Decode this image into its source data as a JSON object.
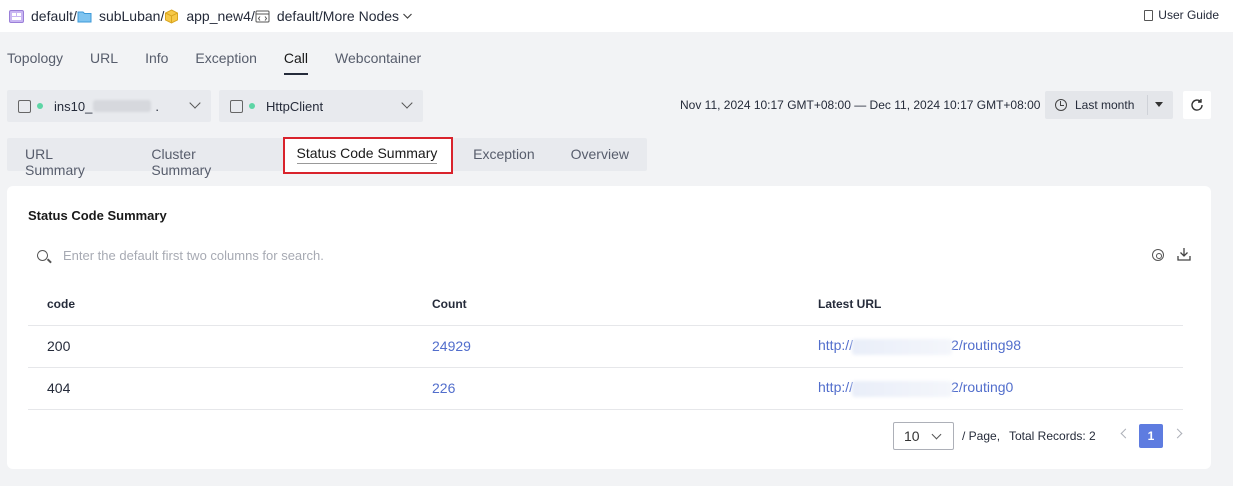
{
  "breadcrumb": {
    "items": [
      {
        "label": "default",
        "icon": "workspace-icon"
      },
      {
        "label": "subLuban",
        "icon": "folder-icon"
      },
      {
        "label": "app_new4",
        "icon": "app-cube-icon"
      },
      {
        "label": "default",
        "icon": "environment-icon"
      },
      {
        "label": "More Nodes",
        "icon": "chevron-down-icon"
      }
    ],
    "separator": "/"
  },
  "user_guide": "User Guide",
  "tabs": [
    "Topology",
    "URL",
    "Info",
    "Exception",
    "Call",
    "Webcontainer"
  ],
  "active_tab": "Call",
  "instance_select": {
    "label": "ins10_",
    "status_color": "#5dd5a5"
  },
  "client_select": {
    "label": "HttpClient",
    "status_color": "#5dd5a5"
  },
  "date_range": "Nov 11, 2024 10:17 GMT+08:00 — Dec 11, 2024 10:17 GMT+08:00",
  "time_range": "Last month",
  "subtabs": [
    "URL Summary",
    "Cluster Summary",
    "Status Code Summary",
    "Exception",
    "Overview"
  ],
  "active_subtab": "Status Code Summary",
  "card": {
    "title": "Status Code Summary",
    "search_placeholder": "Enter the default first two columns for search.",
    "columns": [
      "code",
      "Count",
      "Latest URL"
    ],
    "rows": [
      {
        "code": "200",
        "count": "24929",
        "url_prefix": "http://",
        "url_suffix": "2/routing98"
      },
      {
        "code": "404",
        "count": "226",
        "url_prefix": "http://",
        "url_suffix": "2/routing0"
      }
    ]
  },
  "pagination": {
    "page_size": "10",
    "per_page_label": "/ Page,",
    "total_label": "Total Records: 2",
    "current_page": "1"
  },
  "colors": {
    "accent": "#5e7ce0",
    "link": "#526ecc",
    "highlight_border": "#d9232c"
  }
}
